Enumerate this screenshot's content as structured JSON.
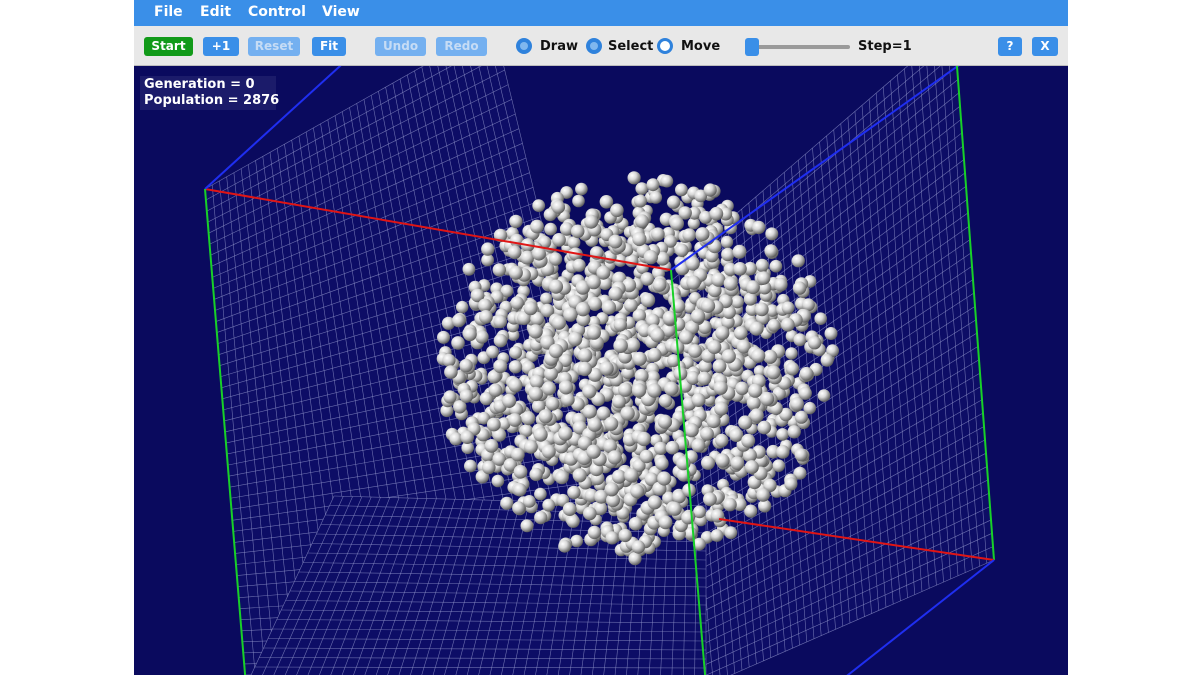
{
  "menu": {
    "file": "File",
    "edit": "Edit",
    "control": "Control",
    "view": "View"
  },
  "toolbar": {
    "start": "Start",
    "step_one": "+1",
    "reset": "Reset",
    "fit": "Fit",
    "undo": "Undo",
    "redo": "Redo",
    "modes": [
      "Draw",
      "Select",
      "Move"
    ],
    "selected_mode": "Move",
    "step_label": "Step=1",
    "help": "?",
    "close": "X"
  },
  "stats": {
    "generation": "Generation = 0",
    "population": "Population = 2876"
  },
  "colors": {
    "background": "#0a0a5e",
    "menubar": "#3a8fe8",
    "grid": "#8e92c8",
    "axis_x": "#e01515",
    "axis_y": "#18d028",
    "axis_z": "#1f2ef0",
    "cell": "#d8d8d8"
  }
}
